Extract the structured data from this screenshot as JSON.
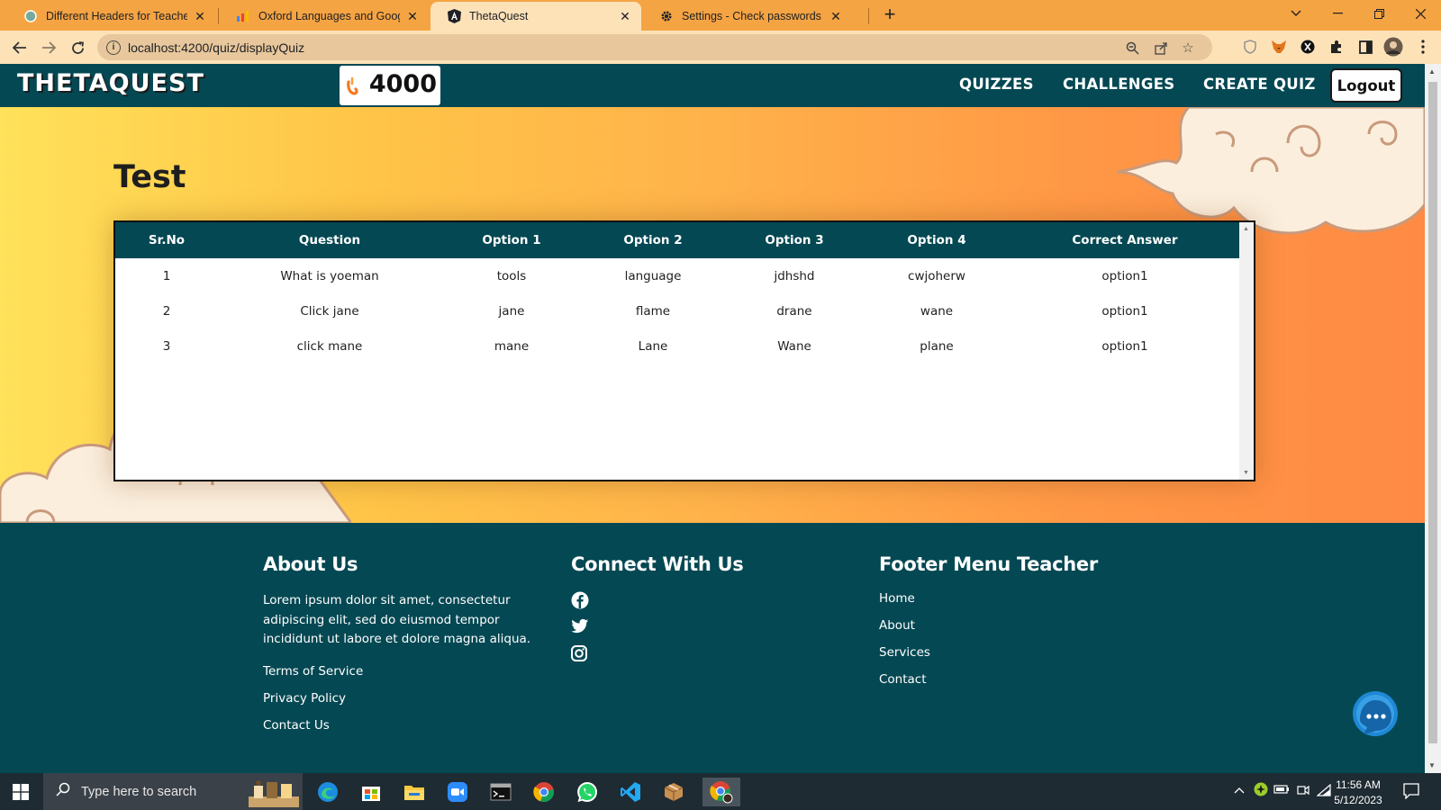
{
  "browser": {
    "tabs": [
      {
        "title": "Different Headers for Teachers ar",
        "active": false
      },
      {
        "title": "Oxford Languages and Google -",
        "active": false
      },
      {
        "title": "ThetaQuest",
        "active": true
      },
      {
        "title": "Settings - Check passwords",
        "active": false
      }
    ],
    "url": "localhost:4200/quiz/displayQuiz",
    "accent": "#f5a443"
  },
  "site": {
    "logo": "THETAQUEST",
    "coins": "4000",
    "nav": [
      "QUIZZES",
      "CHALLENGES",
      "CREATE QUIZ"
    ],
    "logout": "Logout"
  },
  "quiz": {
    "title": "Test",
    "columns": [
      "Sr.No",
      "Question",
      "Option 1",
      "Option 2",
      "Option 3",
      "Option 4",
      "Correct Answer"
    ],
    "rows": [
      [
        "1",
        "What is yoeman",
        "tools",
        "language",
        "jdhshd",
        "cwjoherw",
        "option1"
      ],
      [
        "2",
        "Click jane",
        "jane",
        "flame",
        "drane",
        "wane",
        "option1"
      ],
      [
        "3",
        "click mane",
        "mane",
        "Lane",
        "Wane",
        "plane",
        "option1"
      ]
    ]
  },
  "footer": {
    "about": {
      "heading": "About Us",
      "text": "Lorem ipsum dolor sit amet, consectetur adipiscing elit, sed do eiusmod tempor incididunt ut labore et dolore magna aliqua.",
      "links": [
        "Terms of Service",
        "Privacy Policy",
        "Contact Us"
      ]
    },
    "connect": {
      "heading": "Connect With Us",
      "icons": [
        "facebook-icon",
        "twitter-icon",
        "instagram-icon"
      ]
    },
    "menu": {
      "heading": "Footer Menu Teacher",
      "links": [
        "Home",
        "About",
        "Services",
        "Contact"
      ]
    },
    "color": "#044853"
  },
  "taskbar": {
    "search_placeholder": "Type here to search",
    "time": "11:56 AM",
    "date": "5/12/2023"
  }
}
